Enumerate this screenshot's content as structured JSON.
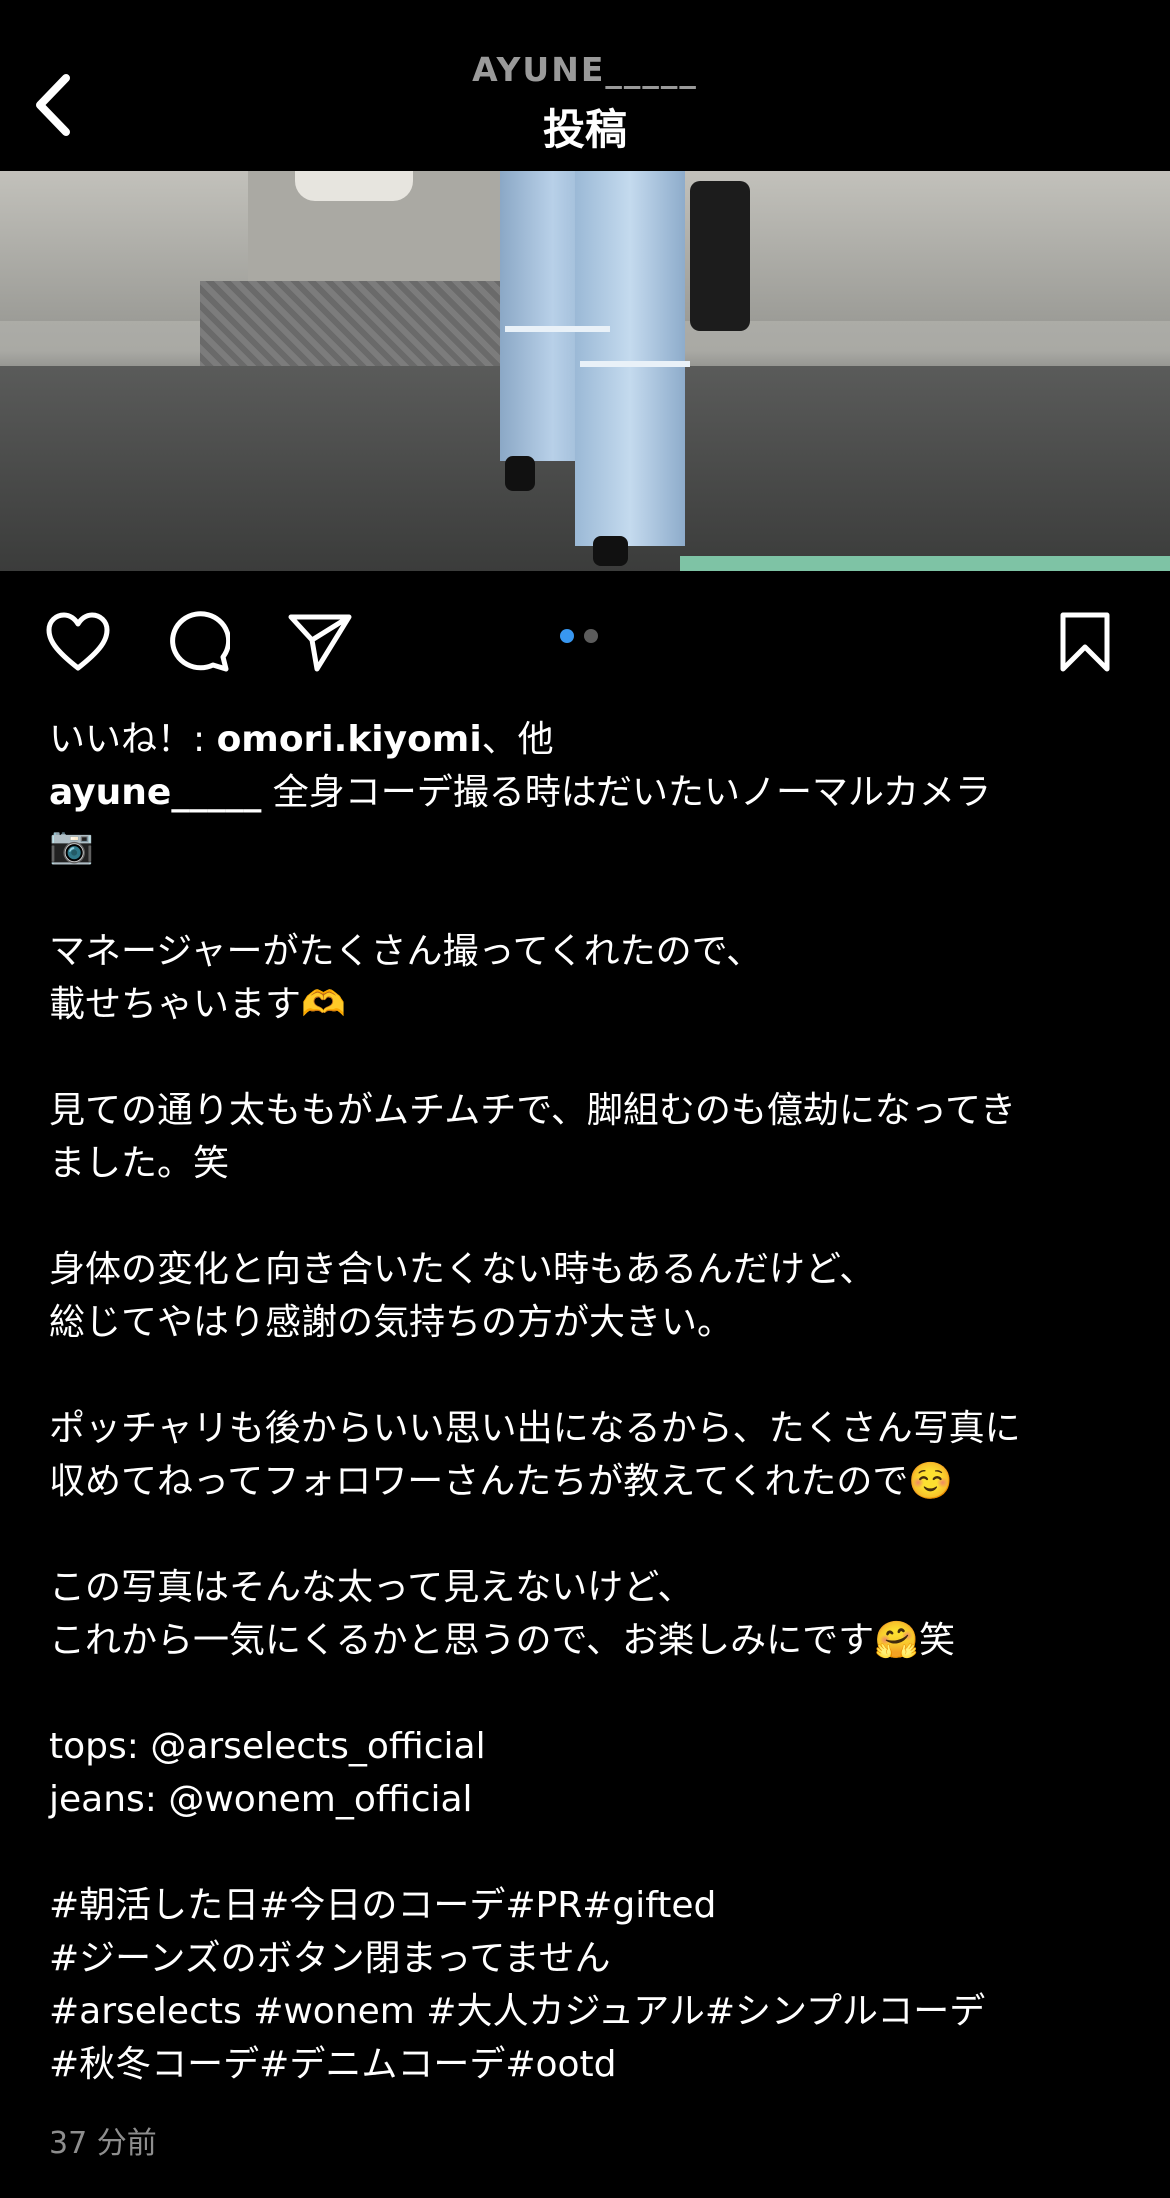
{
  "header": {
    "username": "AYUNE_____",
    "title": "投稿",
    "back_icon": "chevron-left-icon"
  },
  "photo": {
    "description_icon": "photo-image"
  },
  "actions": {
    "like_icon": "heart-icon",
    "comment_icon": "comment-bubble-icon",
    "share_icon": "paper-plane-icon",
    "save_icon": "bookmark-icon",
    "carousel_dots": [
      {
        "active": true
      },
      {
        "active": false
      }
    ],
    "accent_color": "#3897f0"
  },
  "likes": {
    "prefix": "いいね！: ",
    "user": "omori.kiyomi",
    "suffix": "、他"
  },
  "caption": {
    "author": "ayune_____",
    "first_line": " 全身コーデ撮る時はだいたいノーマルカメラ",
    "lines": [
      "📷",
      "",
      "マネージャーがたくさん撮ってくれたので、",
      "載せちゃいます🫶",
      "",
      "見ての通り太ももがムチムチで、脚組むのも億劫になってき",
      "ました。笑",
      "",
      "身体の変化と向き合いたくない時もあるんだけど、",
      "総じてやはり感謝の気持ちの方が大きい。",
      "",
      "ポッチャリも後からいい思い出になるから、たくさん写真に",
      "収めてねってフォロワーさんたちが教えてくれたので☺️",
      "",
      "この写真はそんな太って見えないけど、",
      "これから一気にくるかと思うので、お楽しみにです🤗笑",
      "",
      "tops: @arselects_official",
      "jeans: @wonem_official",
      "",
      "#朝活した日#今日のコーデ#PR#gifted",
      "#ジーンズのボタン閉まってません",
      "#arselects #wonem #大人カジュアル#シンプルコーデ",
      "#秋冬コーデ#デニムコーデ#ootd"
    ]
  },
  "timestamp": "37 分前"
}
